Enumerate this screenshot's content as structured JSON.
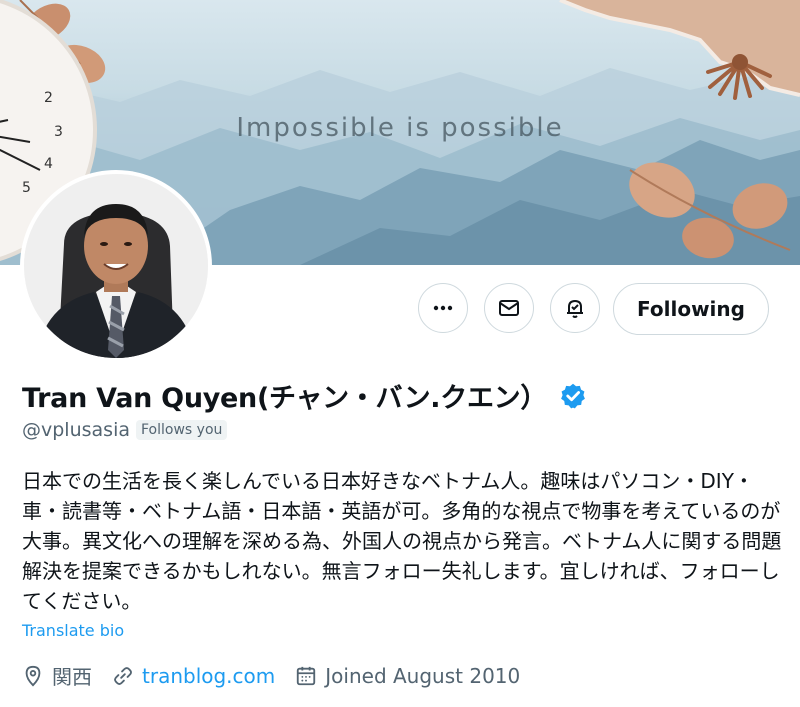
{
  "banner": {
    "motto": "Impossible is possible"
  },
  "clock": {
    "numbers": [
      "2",
      "3",
      "4",
      "5"
    ]
  },
  "profile": {
    "name": "Tran Van Quyen(チャン・バン.クエン）",
    "handle": "@vplusasia",
    "follows_you": "Follows you",
    "bio": "日本での生活を長く楽しんでいる日本好きなベトナム人。趣味はパソコン・DIY・車・読書等・ベトナム語・日本語・英語が可。多角的な視点で物事を考えているのが大事。異文化への理解を深める為、外国人の視点から発言。ベトナム人に関する問題解決を提案できるかもしれない。無言フォロー失礼します。宜しければ、フォローしてください。",
    "translate_label": "Translate bio",
    "location": "関西",
    "website": "tranblog.com",
    "joined": "Joined August 2010"
  },
  "actions": {
    "following_label": "Following"
  },
  "colors": {
    "accent": "#1d9bf0",
    "secondary_text": "#536471",
    "border": "#cfd9de"
  },
  "icons": [
    "more-icon",
    "mail-icon",
    "notification-bell-icon",
    "verified-badge-icon",
    "location-icon",
    "link-icon",
    "calendar-icon"
  ]
}
